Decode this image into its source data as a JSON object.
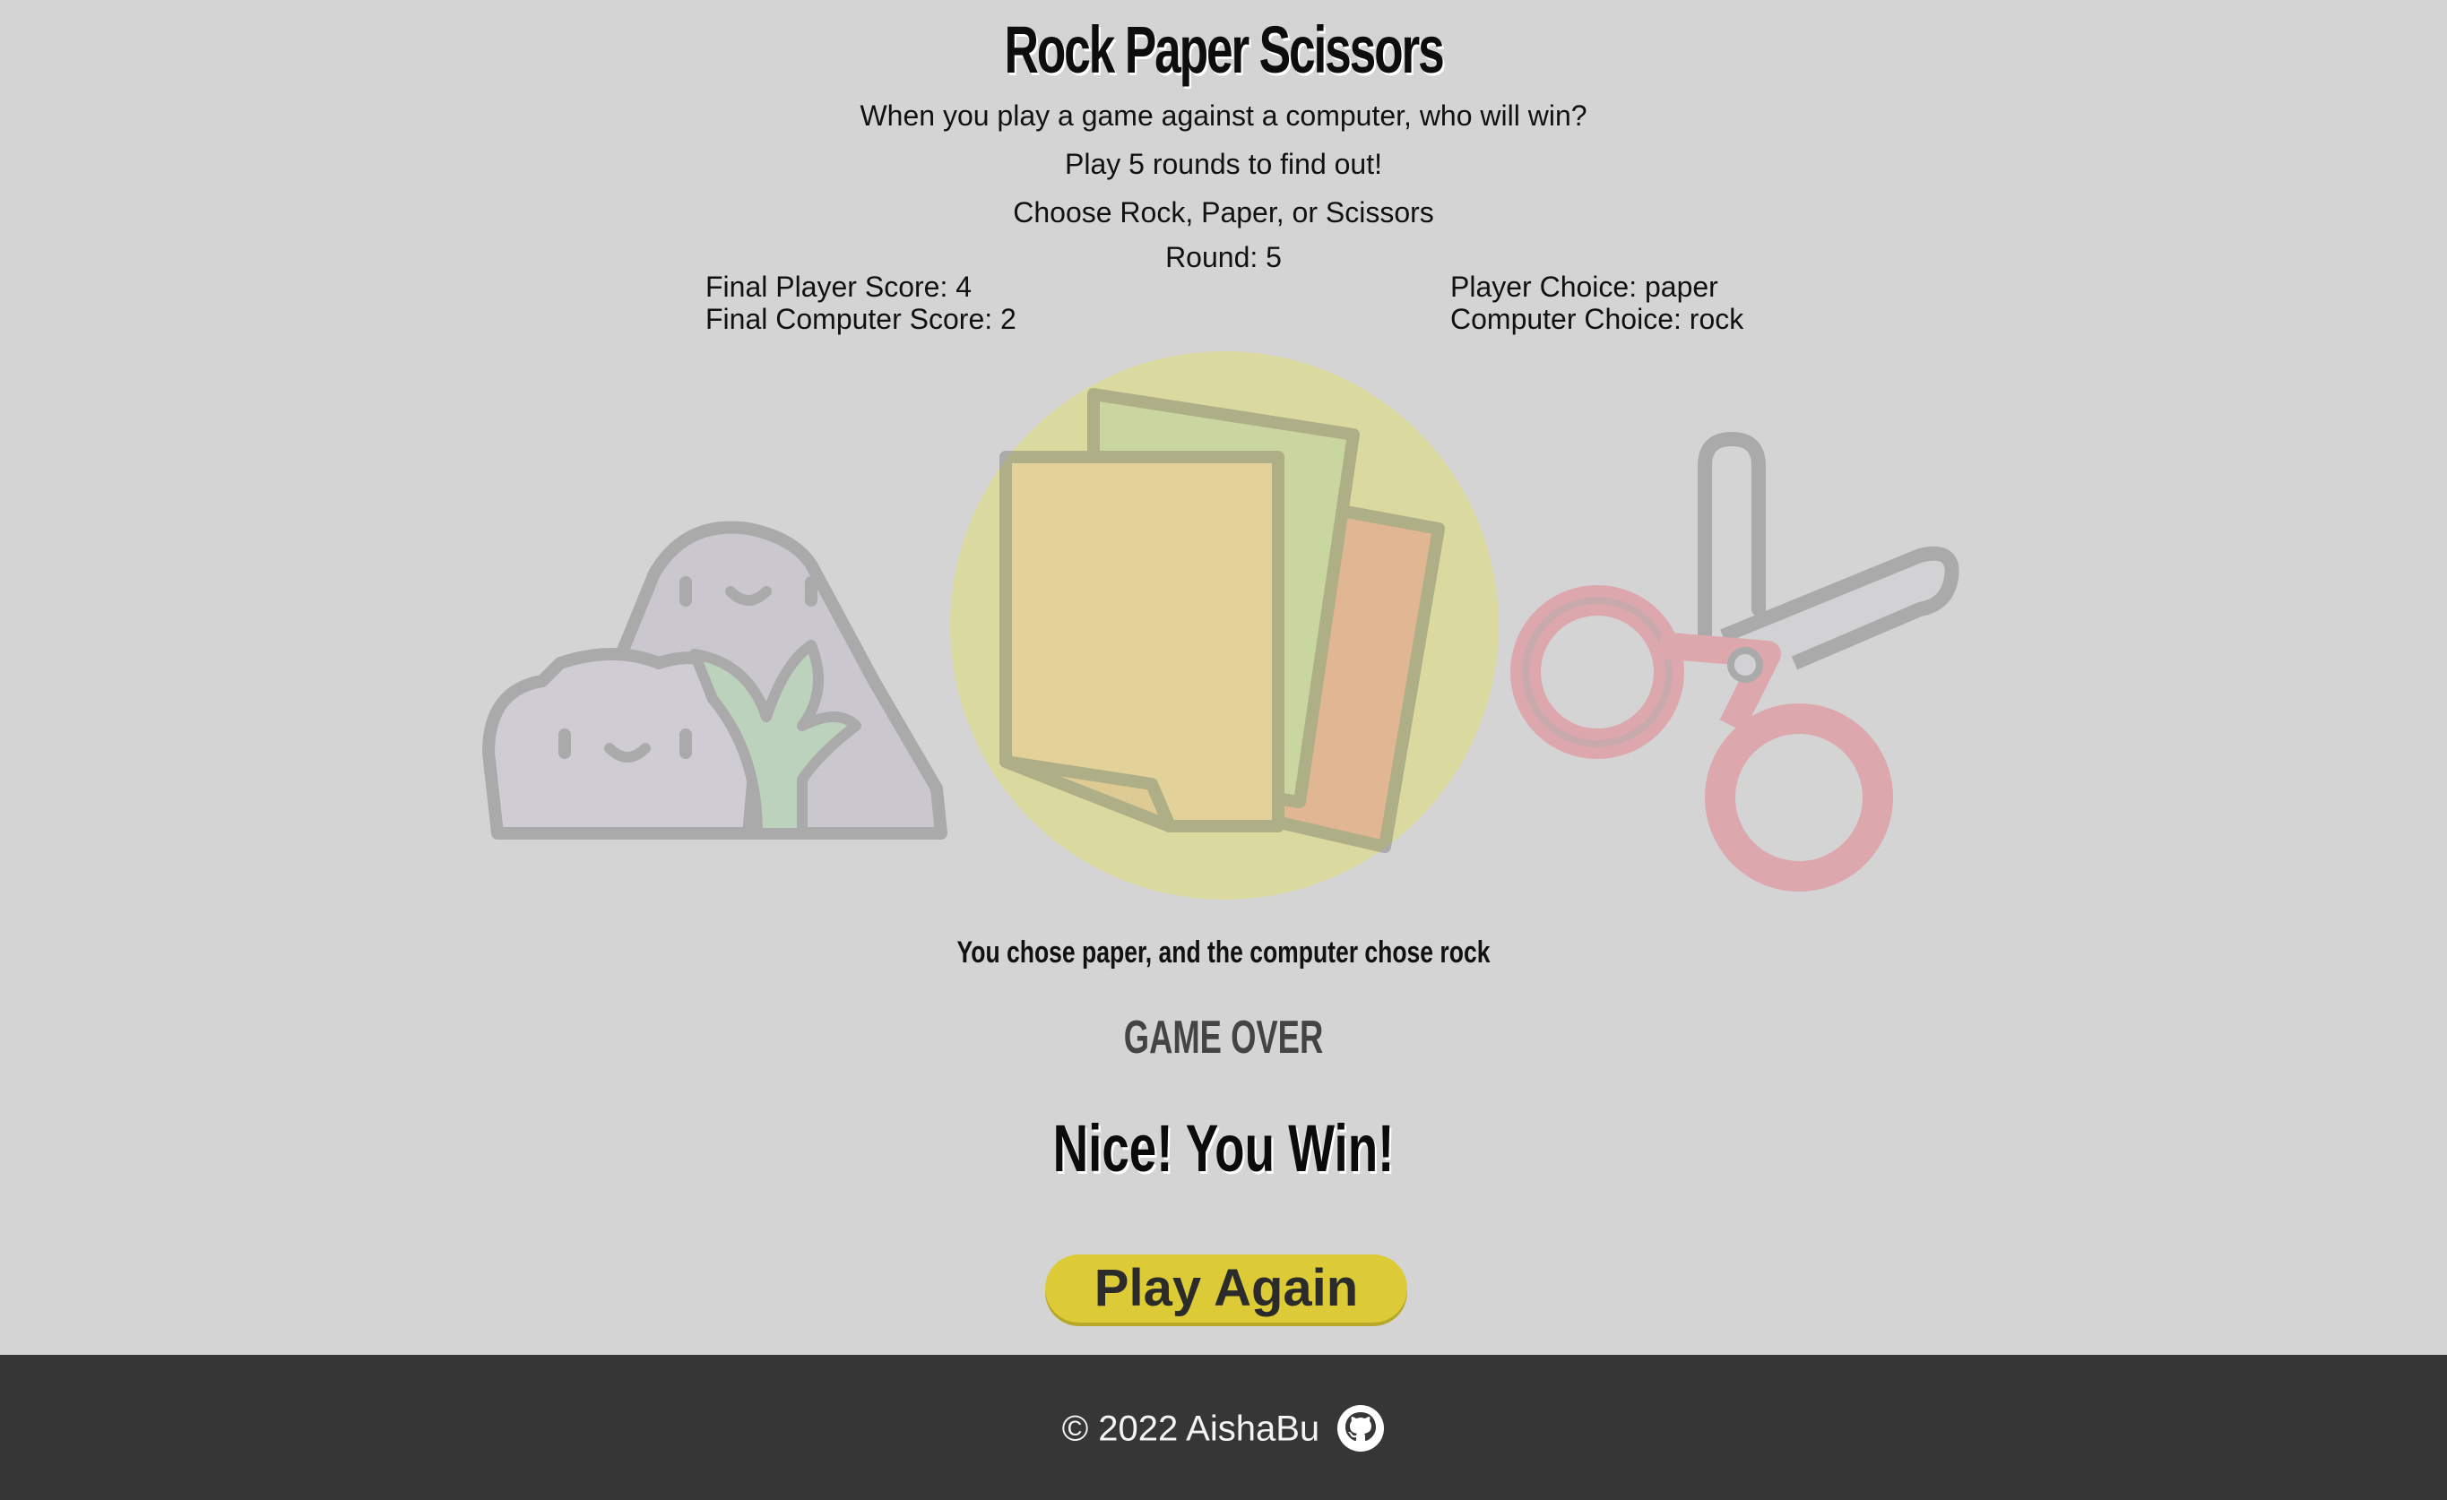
{
  "header": {
    "title": "Rock Paper Scissors",
    "intro_line1": "When you play a game against a computer, who will win?",
    "intro_line2": "Play 5 rounds to find out!",
    "intro_line3": "Choose Rock, Paper, or Scissors"
  },
  "scoreboard": {
    "round": "Round: 5",
    "player_score": "Final Player Score: 4",
    "computer_score": "Final Computer Score: 2",
    "player_choice": "Player Choice: paper",
    "computer_choice": "Computer Choice: rock"
  },
  "choices": [
    {
      "id": "rock",
      "icon": "rock-icon"
    },
    {
      "id": "paper",
      "icon": "paper-icon",
      "highlighted": true
    },
    {
      "id": "scissors",
      "icon": "scissors-icon"
    }
  ],
  "result": {
    "summary": "You chose paper, and the computer chose rock",
    "status": "GAME OVER",
    "outcome": "Nice! You Win!"
  },
  "actions": {
    "play_again_label": "Play Again"
  },
  "footer": {
    "copyright": "© 2022 AishaBu",
    "github_icon": "github-icon"
  },
  "colors": {
    "background": "#d4d4d4",
    "footer_background": "#363636",
    "button": "#dccb36",
    "highlight_circle": "#e8e650"
  }
}
